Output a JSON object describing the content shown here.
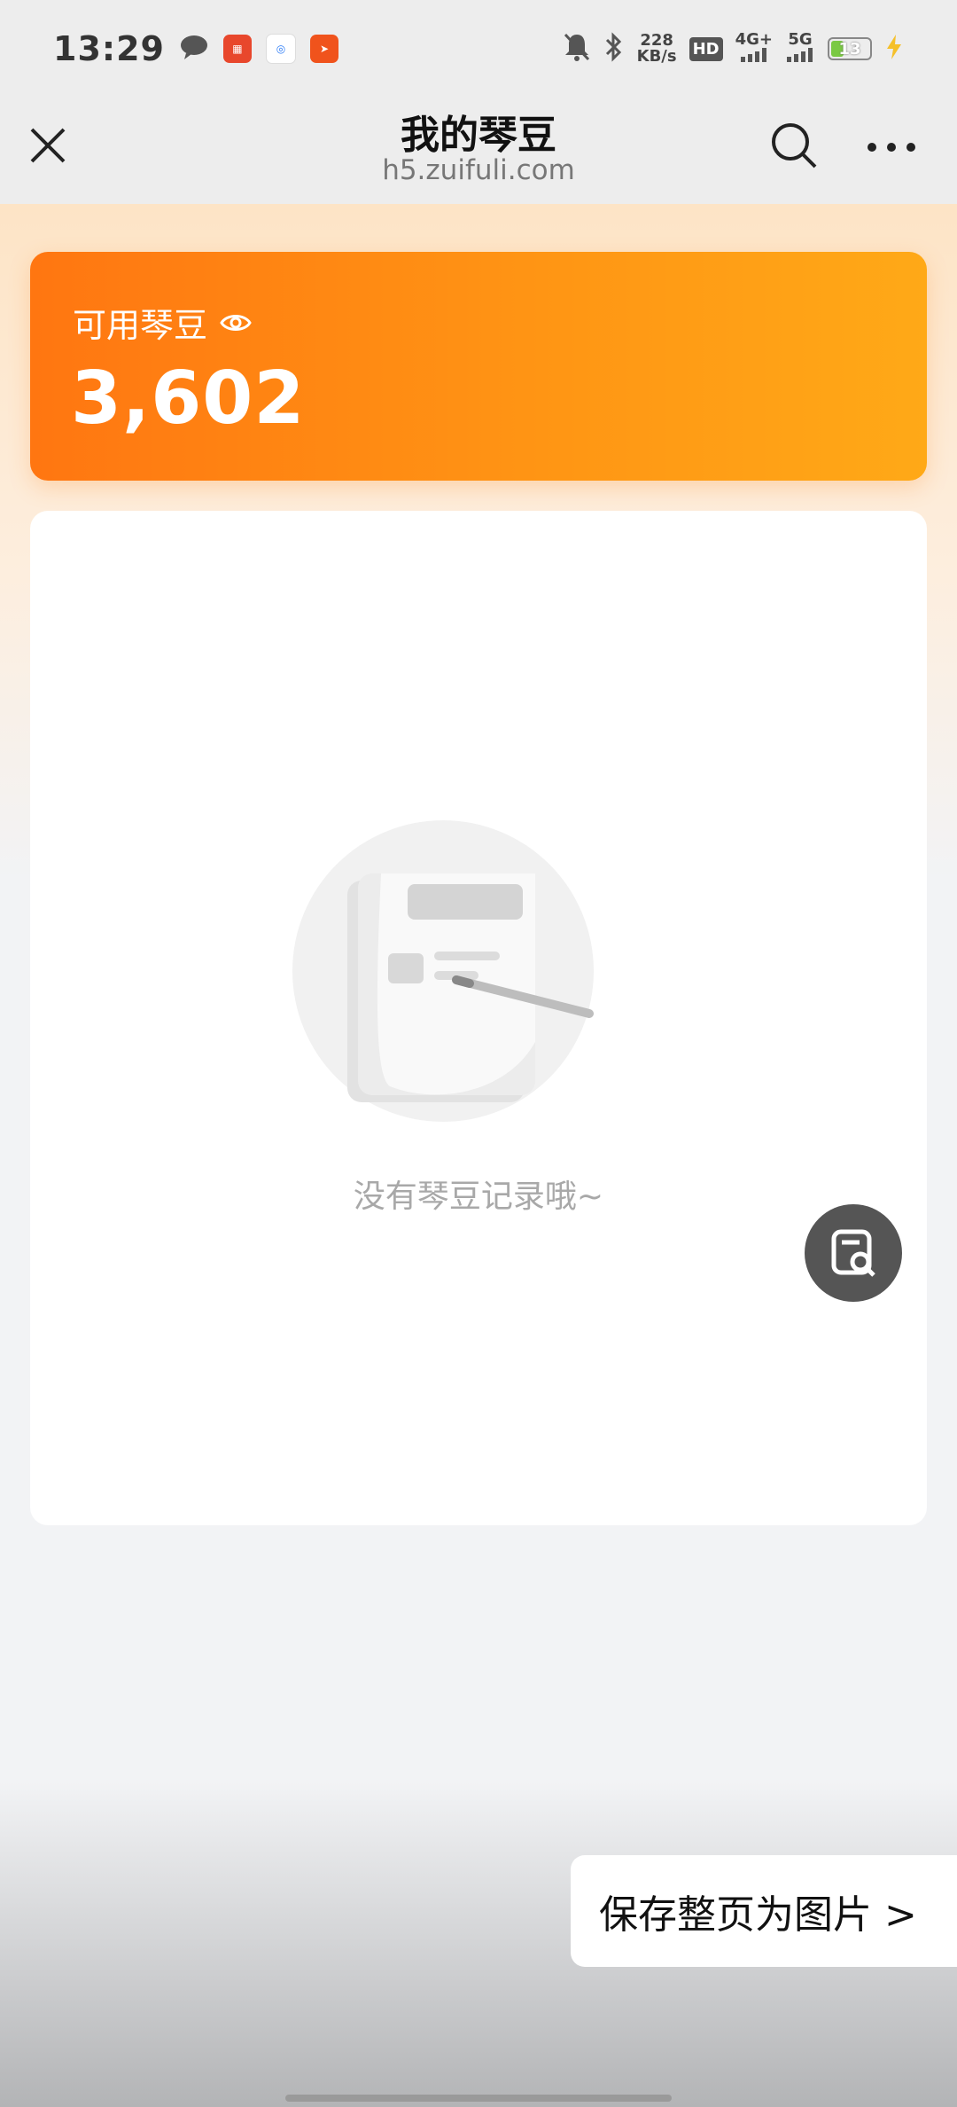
{
  "status_bar": {
    "time": "13:29",
    "notification_icons": [
      "chat-bubble-icon",
      "pingan-bank-app-icon",
      "qq-browser-app-icon",
      "paper-plane-app-icon"
    ],
    "speed_value": "228",
    "speed_unit": "KB/s",
    "hd_label": "HD",
    "net_1": "4G+",
    "net_2": "5G",
    "battery_level": "13"
  },
  "navbar": {
    "title": "我的琴豆",
    "url": "h5.zuifuli.com"
  },
  "balance": {
    "label": "可用琴豆",
    "value": "3,602"
  },
  "records": {
    "empty_text": "没有琴豆记录哦~"
  },
  "save_bar": {
    "label": "保存整页为图片 >"
  },
  "colors": {
    "card_gradient_start": "#ff7611",
    "card_gradient_end": "#ffa917",
    "page_bg": "#f2f3f5",
    "float_button": "#555555"
  }
}
